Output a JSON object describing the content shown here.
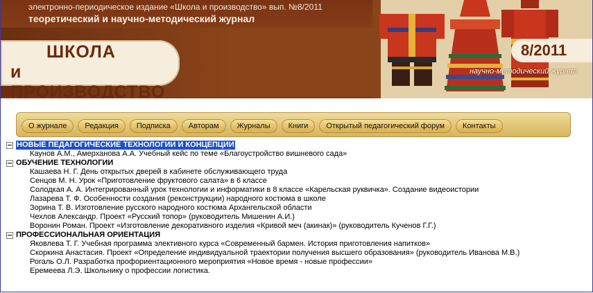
{
  "header": {
    "line1": "электронно-периодическое издание «Школа и производство» вып. №8/2011",
    "line2": "теоретический и научно-методический журнал",
    "logo_line1": "ШКОЛА",
    "logo_line2": "и ПРОИЗВОДСТВО",
    "issue": "8/2011",
    "subline": "научно-методический журнал"
  },
  "nav": [
    "О журнале",
    "Редакция",
    "Подписка",
    "Авторам",
    "Журналы",
    "Книги",
    "Открытый педагогический форум",
    "Контакты"
  ],
  "sections": [
    {
      "title": "НОВЫЕ ПЕДАГОГИЧЕСКИЕ ТЕХНОЛОГИИ И КОНЦЕПЦИИ",
      "items": [
        "Каунов А.М.,  Амерханова А.А. Учебный кейс по теме «Благоустройство вишневого сада»"
      ]
    },
    {
      "title": "ОБУЧЕНИЕ ТЕХНОЛОГИИ",
      "items": [
        "Кашаева Н. Г. День открытых дверей в кабинете обслуживающего труда",
        "Сенцов М. Н. Урок «Приготовление фруктового салата» в 6 классе",
        "Солодкая А. А. Интегрированный урок технологии и информатики в 8 классе «Карельская руквичка». Создание видеоистории",
        "Лазарева Т. Ф. Особенности создания (реконструкции) народного костюма в школе",
        "Зорина Т. В. Изготовление русского народного костюма Архангельской области",
        "Чехлов Александр. Проект «Русский топор» (руководитель Мишенин А.И.)",
        "Воронин Роман. Проект «Изготовление декоративного изделия «Кривой меч (акинак)» (руководитель Кученов Г.Г.)"
      ]
    },
    {
      "title": "ПРОФЕССИОНАЛЬНАЯ ОРИЕНТАЦИЯ",
      "items": [
        "Яковлева Т. Г. Учебная программа элективного курса «Современный бармен. История приготовления напитков»",
        "Скоркина Анастасия. Проект «Определение индивидуальной траектории получения высшего образования» (руководитель Иванова М.В.)",
        "Рогаль О.Л. Разработка профориентационного мероприятия «Новое время - новые профессии»",
        "Еремеева Л.Э. Школьнику о профессии логистика."
      ]
    }
  ]
}
